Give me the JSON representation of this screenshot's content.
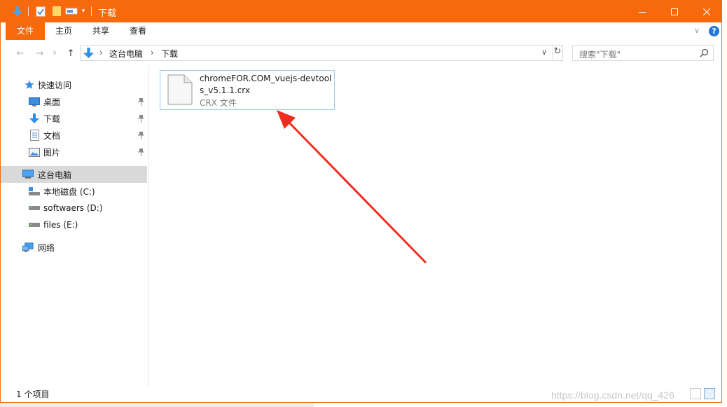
{
  "window": {
    "title": "下载",
    "accent": "#f6690d",
    "controls": {
      "minimize": "minimize-icon",
      "maximize": "maximize-icon",
      "close": "close-icon"
    }
  },
  "ribbon": {
    "tabs": [
      {
        "label": "文件",
        "active": true
      },
      {
        "label": "主页",
        "active": false
      },
      {
        "label": "共享",
        "active": false
      },
      {
        "label": "查看",
        "active": false
      }
    ]
  },
  "address": {
    "crumbs": [
      "这台电脑",
      "下载"
    ],
    "search_placeholder": "搜索\"下载\""
  },
  "nav": {
    "quick_access": "快速访问",
    "pinned": [
      "桌面",
      "下载",
      "文档",
      "图片"
    ],
    "this_pc": "这台电脑",
    "drives": [
      "本地磁盘 (C:)",
      "softwaers (D:)",
      "files (E:)"
    ],
    "network": "网络"
  },
  "files": [
    {
      "name": "chromeFOR.COM_vuejs-devtools_v5.1.1.crx",
      "name_line1": "chromeFOR.COM_vuejs-devtool",
      "name_line2": "s_v5.1.1.crx",
      "type": "CRX 文件"
    }
  ],
  "status": {
    "count": "1 个项目",
    "watermark": "https://blog.csdn.net/qq_426"
  }
}
